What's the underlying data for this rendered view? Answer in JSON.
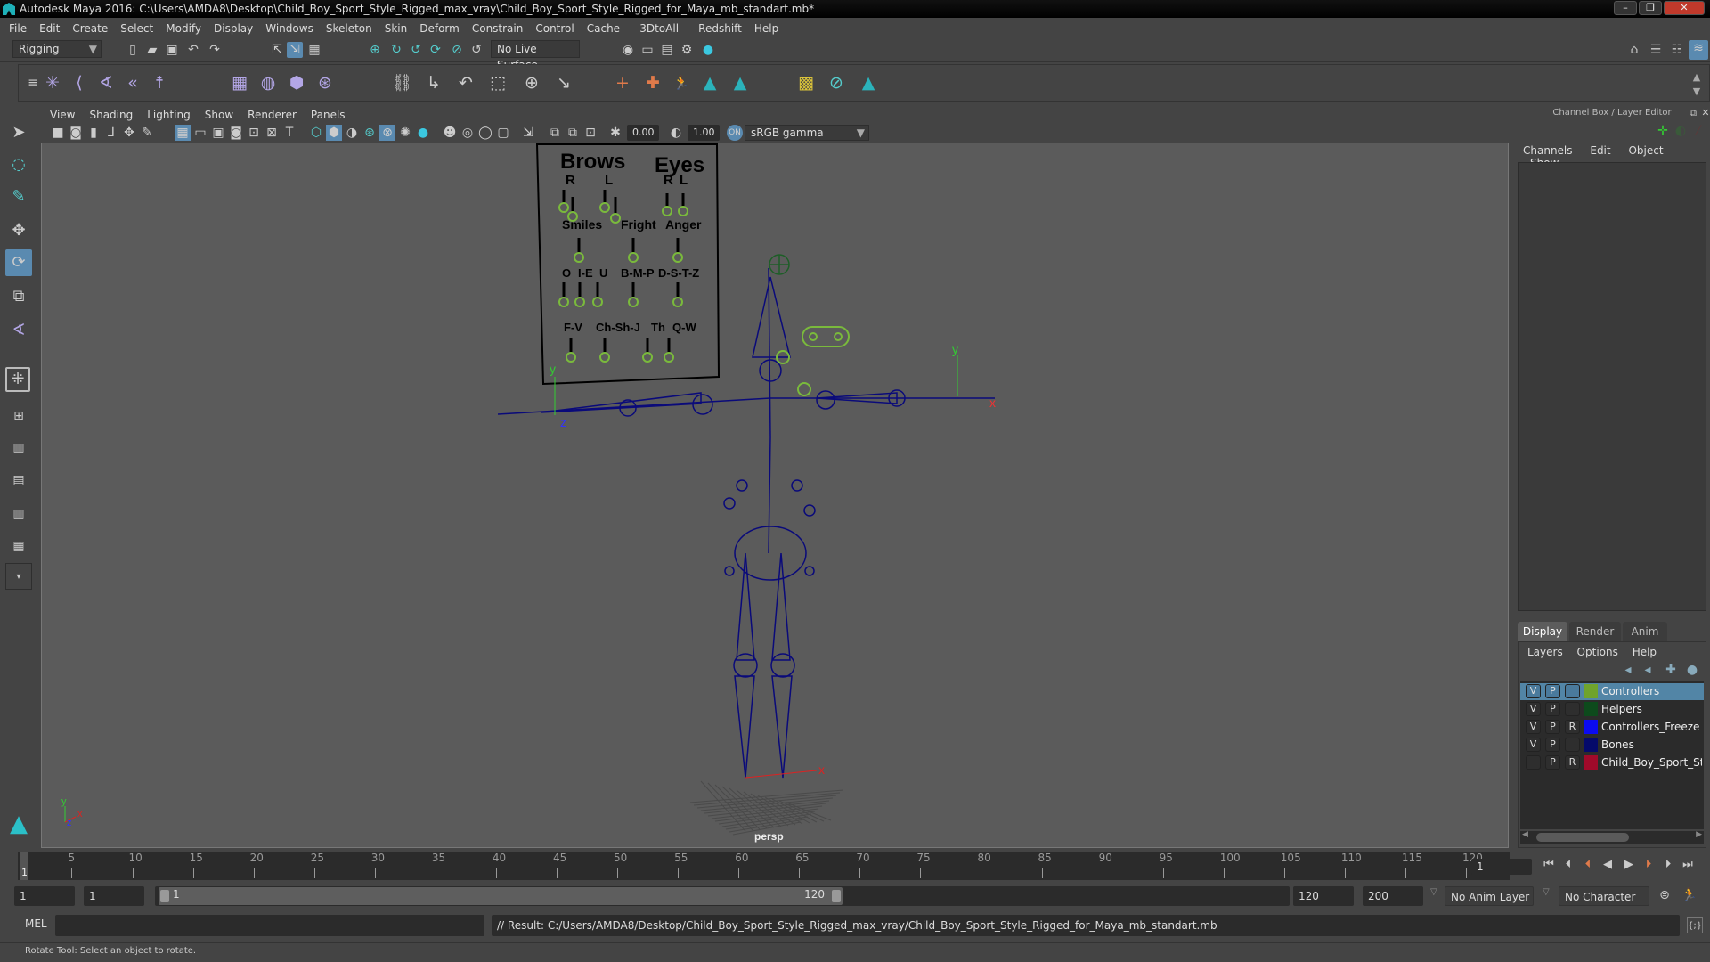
{
  "window": {
    "title": "Autodesk Maya 2016: C:\\Users\\AMDA8\\Desktop\\Child_Boy_Sport_Style_Rigged_max_vray\\Child_Boy_Sport_Style_Rigged_for_Maya_mb_standart.mb*",
    "minimize": "–",
    "restore": "❐",
    "close": "✕"
  },
  "menubar": [
    "File",
    "Edit",
    "Create",
    "Select",
    "Modify",
    "Display",
    "Windows",
    "Skeleton",
    "Skin",
    "Deform",
    "Constrain",
    "Control",
    "Cache",
    "- 3DtoAll -",
    "Redshift",
    "Help"
  ],
  "statusline": {
    "menuset": "Rigging",
    "live_surface": "No Live Surface"
  },
  "shelf": {
    "icons": [
      "joint-tool-icon",
      "ik-handle-icon",
      "ik-spline-icon",
      "insert-joint-icon",
      "humanik-icon",
      "bind-skin-icon",
      "smooth-skin-icon",
      "lattice-icon",
      "cluster-icon",
      "parent-constraint-icon",
      "point-constraint-icon",
      "orient-constraint-icon",
      "scale-constraint-icon",
      "aim-constraint-icon",
      "pole-vector-icon",
      "locator-icon",
      "character-icon",
      "runner-icon",
      "maya-logo-icon",
      "maya-logo-icon-2",
      "paint-weights-icon",
      "lasso-icon",
      "maya-logo-icon-3"
    ]
  },
  "viewport": {
    "menus": [
      "View",
      "Shading",
      "Lighting",
      "Show",
      "Renderer",
      "Panels"
    ],
    "near_value": "0.00",
    "far_value": "1.00",
    "color_space": "sRGB gamma",
    "camera_label": "persp",
    "axis": {
      "x": "x",
      "y": "y",
      "z": "z"
    },
    "face_board": {
      "headers": [
        "Brows",
        "Eyes"
      ],
      "brows_sides": [
        "R",
        "L"
      ],
      "eyes_sides": [
        "R",
        "L"
      ],
      "row2": [
        "Smiles",
        "Fright",
        "Anger"
      ],
      "row3": [
        "O",
        "I-E",
        "U",
        "B-M-P",
        "D-S-T-Z"
      ],
      "row4": [
        "F-V",
        "Ch-Sh-J",
        "Th",
        "Q-W"
      ]
    }
  },
  "channel_box": {
    "title": "Channel Box / Layer Editor",
    "menus": [
      "Channels",
      "Edit",
      "Object",
      "Show"
    ]
  },
  "layer_editor": {
    "tabs": [
      "Display",
      "Render",
      "Anim"
    ],
    "active_tab": "Display",
    "menus": [
      "Layers",
      "Options",
      "Help"
    ],
    "layers": [
      {
        "v": "V",
        "p": "P",
        "r": "",
        "name": "Controllers",
        "color": "#6fa32c",
        "selected": true
      },
      {
        "v": "V",
        "p": "P",
        "r": "",
        "name": "Helpers",
        "color": "#0d4a1c",
        "selected": false
      },
      {
        "v": "V",
        "p": "P",
        "r": "R",
        "name": "Controllers_Freeze",
        "color": "#0b0bf0",
        "selected": false
      },
      {
        "v": "V",
        "p": "P",
        "r": "",
        "name": "Bones",
        "color": "#050a6a",
        "selected": false
      },
      {
        "v": "",
        "p": "P",
        "r": "R",
        "name": "Child_Boy_Sport_Style",
        "color": "#a00a2a",
        "selected": false
      }
    ]
  },
  "timeline": {
    "ticks": [
      1,
      5,
      10,
      15,
      20,
      25,
      30,
      35,
      40,
      45,
      50,
      55,
      60,
      65,
      70,
      75,
      80,
      85,
      90,
      95,
      100,
      105,
      110,
      115,
      120
    ],
    "start": 1,
    "end": 120,
    "current_frame": "1"
  },
  "range": {
    "start_time": "1",
    "playback_start": "1",
    "slider_start": "1",
    "slider_end": "120",
    "playback_end": "120",
    "end_time": "200",
    "anim_layer": "No Anim Layer",
    "character_set": "No Character Set"
  },
  "command_line": {
    "language": "MEL",
    "input": "",
    "result": "// Result: C:/Users/AMDA8/Desktop/Child_Boy_Sport_Style_Rigged_max_vray/Child_Boy_Sport_Style_Rigged_for_Maya_mb_standart.mb"
  },
  "help_line": "Rotate Tool: Select an object to rotate."
}
